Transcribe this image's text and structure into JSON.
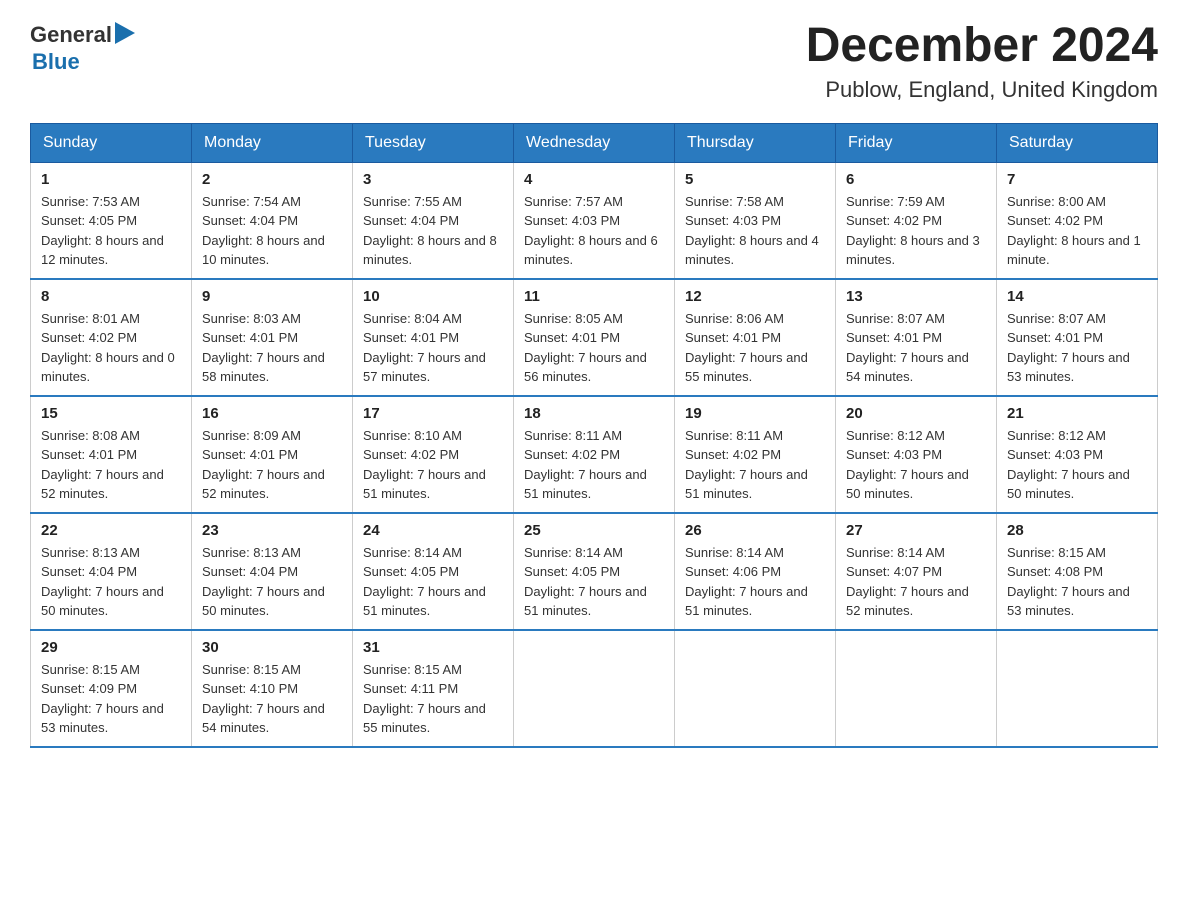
{
  "header": {
    "logo_general": "General",
    "logo_blue": "Blue",
    "title": "December 2024",
    "subtitle": "Publow, England, United Kingdom"
  },
  "calendar": {
    "days_of_week": [
      "Sunday",
      "Monday",
      "Tuesday",
      "Wednesday",
      "Thursday",
      "Friday",
      "Saturday"
    ],
    "weeks": [
      [
        {
          "day": "1",
          "sunrise": "7:53 AM",
          "sunset": "4:05 PM",
          "daylight": "8 hours and 12 minutes."
        },
        {
          "day": "2",
          "sunrise": "7:54 AM",
          "sunset": "4:04 PM",
          "daylight": "8 hours and 10 minutes."
        },
        {
          "day": "3",
          "sunrise": "7:55 AM",
          "sunset": "4:04 PM",
          "daylight": "8 hours and 8 minutes."
        },
        {
          "day": "4",
          "sunrise": "7:57 AM",
          "sunset": "4:03 PM",
          "daylight": "8 hours and 6 minutes."
        },
        {
          "day": "5",
          "sunrise": "7:58 AM",
          "sunset": "4:03 PM",
          "daylight": "8 hours and 4 minutes."
        },
        {
          "day": "6",
          "sunrise": "7:59 AM",
          "sunset": "4:02 PM",
          "daylight": "8 hours and 3 minutes."
        },
        {
          "day": "7",
          "sunrise": "8:00 AM",
          "sunset": "4:02 PM",
          "daylight": "8 hours and 1 minute."
        }
      ],
      [
        {
          "day": "8",
          "sunrise": "8:01 AM",
          "sunset": "4:02 PM",
          "daylight": "8 hours and 0 minutes."
        },
        {
          "day": "9",
          "sunrise": "8:03 AM",
          "sunset": "4:01 PM",
          "daylight": "7 hours and 58 minutes."
        },
        {
          "day": "10",
          "sunrise": "8:04 AM",
          "sunset": "4:01 PM",
          "daylight": "7 hours and 57 minutes."
        },
        {
          "day": "11",
          "sunrise": "8:05 AM",
          "sunset": "4:01 PM",
          "daylight": "7 hours and 56 minutes."
        },
        {
          "day": "12",
          "sunrise": "8:06 AM",
          "sunset": "4:01 PM",
          "daylight": "7 hours and 55 minutes."
        },
        {
          "day": "13",
          "sunrise": "8:07 AM",
          "sunset": "4:01 PM",
          "daylight": "7 hours and 54 minutes."
        },
        {
          "day": "14",
          "sunrise": "8:07 AM",
          "sunset": "4:01 PM",
          "daylight": "7 hours and 53 minutes."
        }
      ],
      [
        {
          "day": "15",
          "sunrise": "8:08 AM",
          "sunset": "4:01 PM",
          "daylight": "7 hours and 52 minutes."
        },
        {
          "day": "16",
          "sunrise": "8:09 AM",
          "sunset": "4:01 PM",
          "daylight": "7 hours and 52 minutes."
        },
        {
          "day": "17",
          "sunrise": "8:10 AM",
          "sunset": "4:02 PM",
          "daylight": "7 hours and 51 minutes."
        },
        {
          "day": "18",
          "sunrise": "8:11 AM",
          "sunset": "4:02 PM",
          "daylight": "7 hours and 51 minutes."
        },
        {
          "day": "19",
          "sunrise": "8:11 AM",
          "sunset": "4:02 PM",
          "daylight": "7 hours and 51 minutes."
        },
        {
          "day": "20",
          "sunrise": "8:12 AM",
          "sunset": "4:03 PM",
          "daylight": "7 hours and 50 minutes."
        },
        {
          "day": "21",
          "sunrise": "8:12 AM",
          "sunset": "4:03 PM",
          "daylight": "7 hours and 50 minutes."
        }
      ],
      [
        {
          "day": "22",
          "sunrise": "8:13 AM",
          "sunset": "4:04 PM",
          "daylight": "7 hours and 50 minutes."
        },
        {
          "day": "23",
          "sunrise": "8:13 AM",
          "sunset": "4:04 PM",
          "daylight": "7 hours and 50 minutes."
        },
        {
          "day": "24",
          "sunrise": "8:14 AM",
          "sunset": "4:05 PM",
          "daylight": "7 hours and 51 minutes."
        },
        {
          "day": "25",
          "sunrise": "8:14 AM",
          "sunset": "4:05 PM",
          "daylight": "7 hours and 51 minutes."
        },
        {
          "day": "26",
          "sunrise": "8:14 AM",
          "sunset": "4:06 PM",
          "daylight": "7 hours and 51 minutes."
        },
        {
          "day": "27",
          "sunrise": "8:14 AM",
          "sunset": "4:07 PM",
          "daylight": "7 hours and 52 minutes."
        },
        {
          "day": "28",
          "sunrise": "8:15 AM",
          "sunset": "4:08 PM",
          "daylight": "7 hours and 53 minutes."
        }
      ],
      [
        {
          "day": "29",
          "sunrise": "8:15 AM",
          "sunset": "4:09 PM",
          "daylight": "7 hours and 53 minutes."
        },
        {
          "day": "30",
          "sunrise": "8:15 AM",
          "sunset": "4:10 PM",
          "daylight": "7 hours and 54 minutes."
        },
        {
          "day": "31",
          "sunrise": "8:15 AM",
          "sunset": "4:11 PM",
          "daylight": "7 hours and 55 minutes."
        },
        null,
        null,
        null,
        null
      ]
    ]
  }
}
